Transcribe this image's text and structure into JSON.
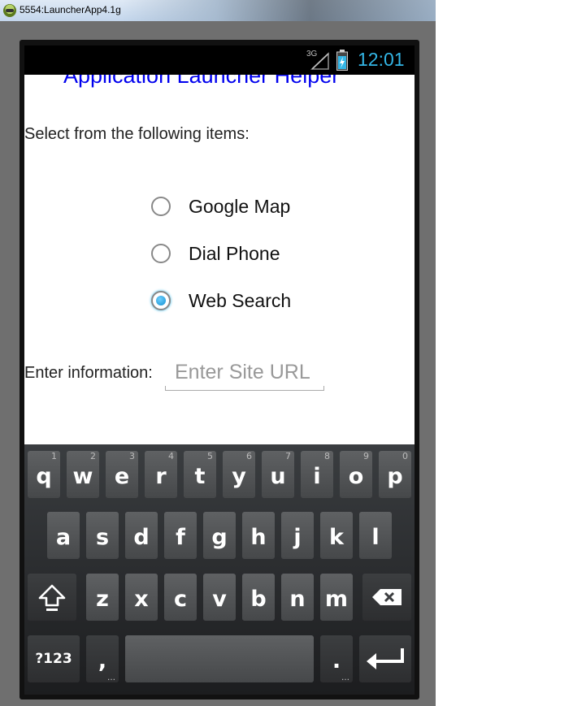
{
  "window": {
    "title": "5554:LauncherApp4.1g"
  },
  "status_bar": {
    "network": "3G",
    "time": "12:01",
    "accent_color": "#33b5e5"
  },
  "app": {
    "title": "Application Launcher Helper",
    "prompt": "Select from the following items:",
    "options": [
      {
        "label": "Google Map",
        "checked": false
      },
      {
        "label": "Dial Phone",
        "checked": false
      },
      {
        "label": "Web Search",
        "checked": true
      }
    ],
    "info_label": "Enter information:",
    "input": {
      "value": "",
      "placeholder": "Enter Site URL"
    }
  },
  "keyboard": {
    "row1": [
      {
        "key": "q",
        "hint": "1"
      },
      {
        "key": "w",
        "hint": "2"
      },
      {
        "key": "e",
        "hint": "3"
      },
      {
        "key": "r",
        "hint": "4"
      },
      {
        "key": "t",
        "hint": "5"
      },
      {
        "key": "y",
        "hint": "6"
      },
      {
        "key": "u",
        "hint": "7"
      },
      {
        "key": "i",
        "hint": "8"
      },
      {
        "key": "o",
        "hint": "9"
      },
      {
        "key": "p",
        "hint": "0"
      }
    ],
    "row2": [
      "a",
      "s",
      "d",
      "f",
      "g",
      "h",
      "j",
      "k",
      "l"
    ],
    "row3": [
      "z",
      "x",
      "c",
      "v",
      "b",
      "n",
      "m"
    ],
    "symbols_label": "?123",
    "comma": ",",
    "period": ".",
    "icons": {
      "shift": "shift-icon",
      "backspace": "backspace-icon",
      "enter": "enter-icon"
    }
  }
}
